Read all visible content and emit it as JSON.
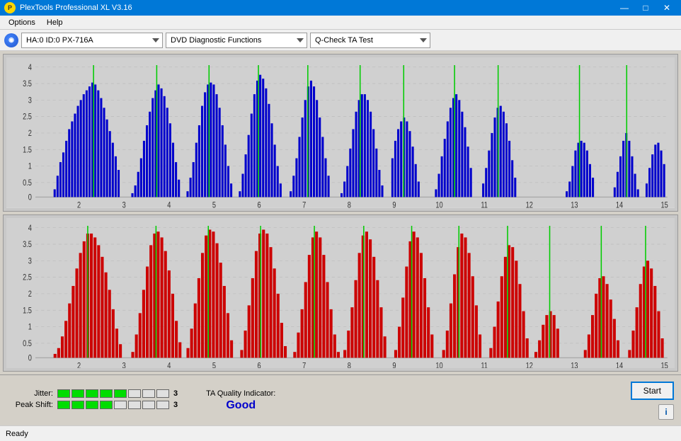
{
  "titlebar": {
    "title": "PlexTools Professional XL V3.16",
    "icon": "P",
    "minimize": "—",
    "maximize": "□",
    "close": "✕"
  },
  "menubar": {
    "items": [
      "Options",
      "Help"
    ]
  },
  "toolbar": {
    "drive": "HA:0 ID:0  PX-716A",
    "function": "DVD Diagnostic Functions",
    "test": "Q-Check TA Test"
  },
  "charts": {
    "top": {
      "color_bar": "#0000cc",
      "color_line": "#00cc00",
      "y_max": 4,
      "y_labels": [
        "4",
        "3.5",
        "3",
        "2.5",
        "2",
        "1.5",
        "1",
        "0.5",
        "0"
      ],
      "x_labels": [
        "2",
        "3",
        "4",
        "5",
        "6",
        "7",
        "8",
        "9",
        "10",
        "11",
        "12",
        "13",
        "14",
        "15"
      ]
    },
    "bottom": {
      "color_bar": "#cc0000",
      "color_line": "#00cc00",
      "y_max": 4,
      "y_labels": [
        "4",
        "3.5",
        "3",
        "2.5",
        "2",
        "1.5",
        "1",
        "0.5",
        "0"
      ],
      "x_labels": [
        "2",
        "3",
        "4",
        "5",
        "6",
        "7",
        "8",
        "9",
        "10",
        "11",
        "12",
        "13",
        "14",
        "15"
      ]
    }
  },
  "metrics": {
    "jitter_label": "Jitter:",
    "jitter_filled": 5,
    "jitter_empty": 3,
    "jitter_value": "3",
    "peak_shift_label": "Peak Shift:",
    "peak_shift_filled": 4,
    "peak_shift_empty": 4,
    "peak_shift_value": "3",
    "ta_quality_label": "TA Quality Indicator:",
    "ta_quality_value": "Good"
  },
  "buttons": {
    "start": "Start",
    "info": "i"
  },
  "statusbar": {
    "text": "Ready"
  }
}
